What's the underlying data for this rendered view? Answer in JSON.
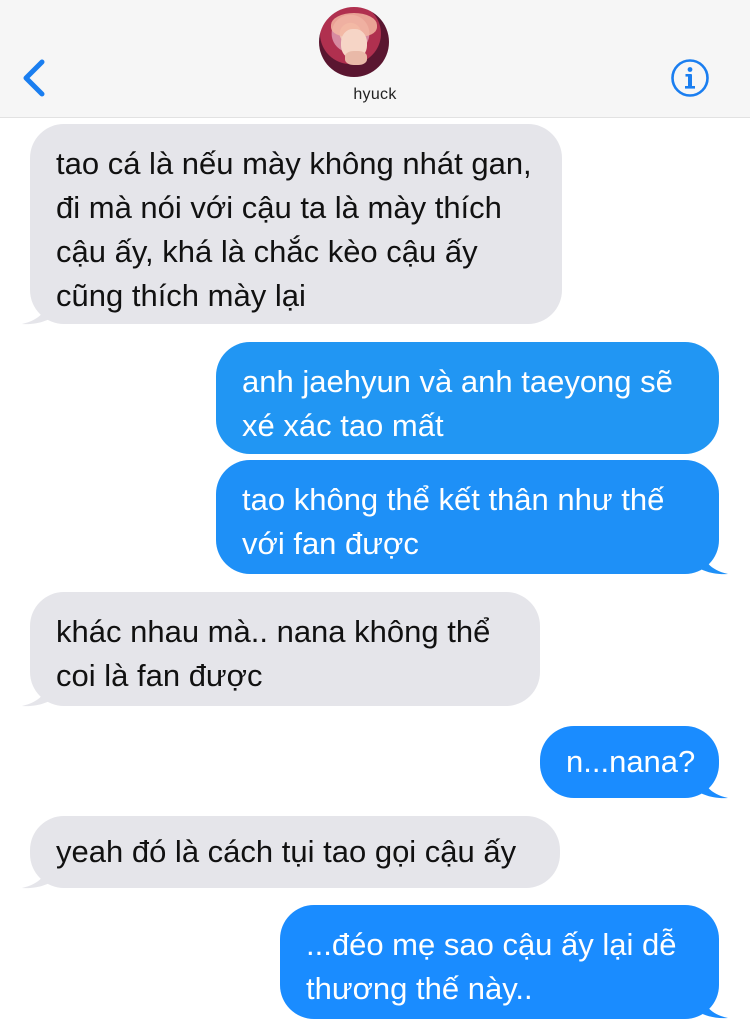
{
  "header": {
    "contact_name": "hyuck",
    "back_icon": "chevron-left-icon",
    "info_icon": "info-icon",
    "accent_color": "#1a7ef0"
  },
  "messages": [
    {
      "direction": "received",
      "text": "tao cá là nếu mày không nhát gan, đi mà nói với cậu ta là mày thích cậu ấy, khá là chắc kèo cậu ấy cũng thích mày lại"
    },
    {
      "direction": "sent",
      "text": "anh jaehyun và anh taeyong sẽ xé xác tao mất"
    },
    {
      "direction": "sent",
      "text": "tao không thể kết thân như thế với fan được"
    },
    {
      "direction": "received",
      "text": "khác nhau mà.. nana không thể coi là fan được"
    },
    {
      "direction": "sent",
      "text": "n...nana?"
    },
    {
      "direction": "received",
      "text": "yeah đó là cách tụi tao gọi cậu ấy"
    },
    {
      "direction": "sent",
      "text": "...đéo mẹ sao cậu ấy lại dễ thương thế này.."
    }
  ],
  "colors": {
    "received_bubble": "#e5e5ea",
    "sent_bubble": "#1a8cff",
    "header_bg": "#f6f6f6"
  }
}
